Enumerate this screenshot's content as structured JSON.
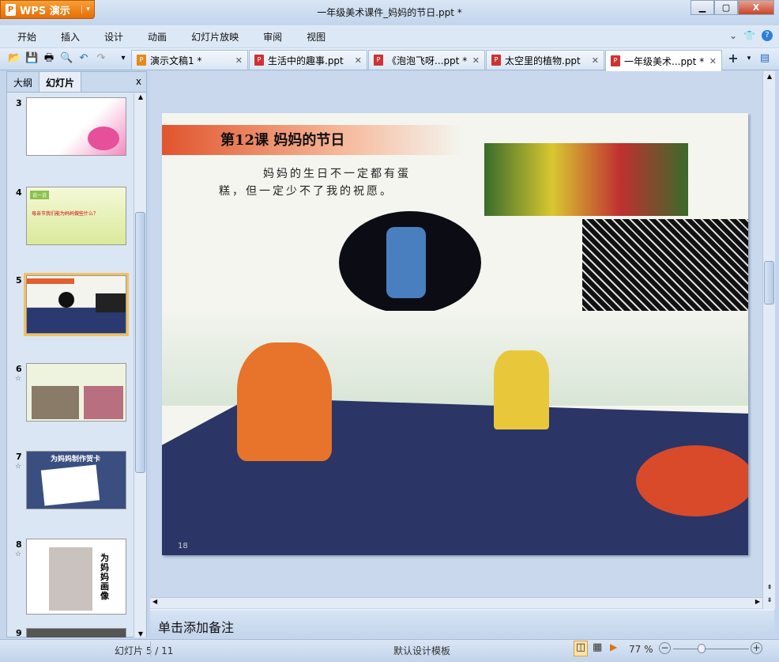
{
  "app": {
    "name": "WPS 演示",
    "title": "一年级美术课件_妈妈的节日.ppt *"
  },
  "menu": [
    "开始",
    "插入",
    "设计",
    "动画",
    "幻灯片放映",
    "审阅",
    "视图"
  ],
  "tabs": [
    {
      "label": "演示文稿1 *",
      "active": false
    },
    {
      "label": "生活中的趣事.ppt",
      "active": false
    },
    {
      "label": "《泡泡飞呀...ppt *",
      "active": false
    },
    {
      "label": "太空里的植物.ppt",
      "active": false
    },
    {
      "label": "一年级美术...ppt *",
      "active": true
    }
  ],
  "panel": {
    "tabs": [
      "大纲",
      "幻灯片"
    ],
    "close": "x"
  },
  "thumbnails": [
    {
      "num": "3"
    },
    {
      "num": "4",
      "text": "说一说",
      "q": "母亲节我们能为妈妈做些什么？"
    },
    {
      "num": "5"
    },
    {
      "num": "6"
    },
    {
      "num": "7",
      "text": "为妈妈制作贺卡"
    },
    {
      "num": "8",
      "text": "为妈妈画像"
    },
    {
      "num": "9"
    }
  ],
  "slide": {
    "title": "第12课  妈妈的节日",
    "body": "妈妈的生日不一定都有蛋糕，但一定少不了我的祝愿。",
    "page": "18"
  },
  "notes": {
    "placeholder": "单击添加备注"
  },
  "status": {
    "slide": "幻灯片 5 / 11",
    "template": "默认设计模板",
    "zoom": "77 %",
    "zoom_value": 77
  }
}
